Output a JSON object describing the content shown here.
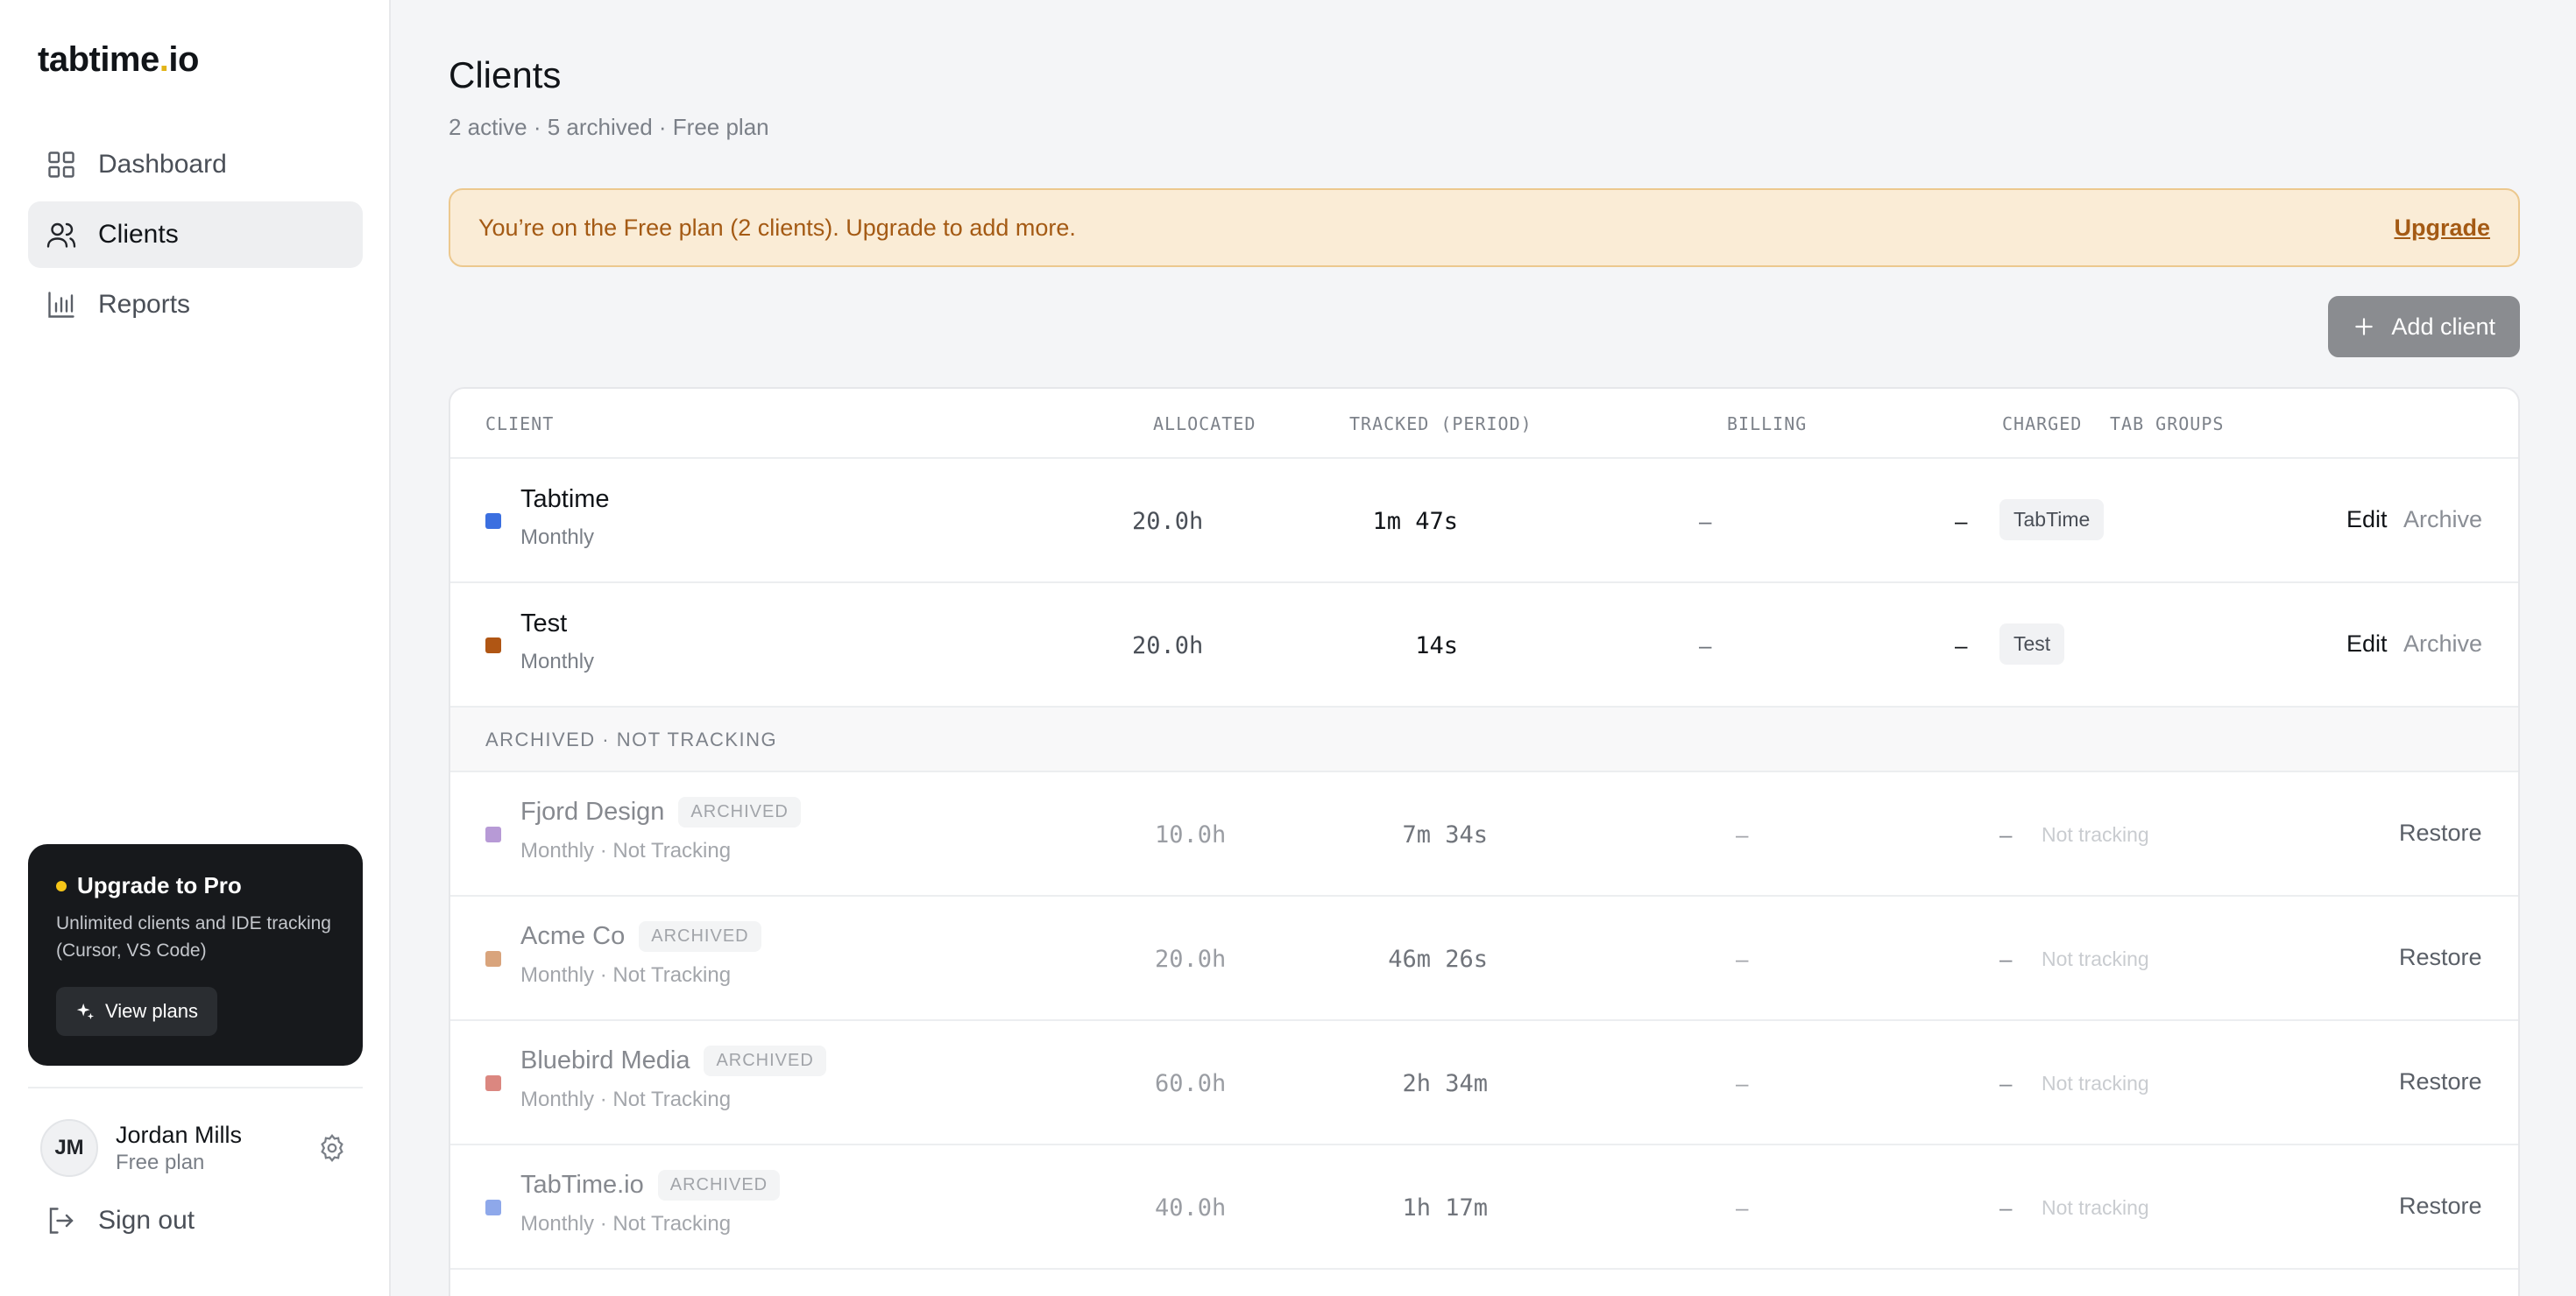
{
  "brand": {
    "name_main": "tabtime",
    "name_dot": ".",
    "name_tld": "io"
  },
  "nav": [
    {
      "label": "Dashboard",
      "icon": "grid-icon",
      "active": false
    },
    {
      "label": "Clients",
      "icon": "users-icon",
      "active": true
    },
    {
      "label": "Reports",
      "icon": "bar-chart-icon",
      "active": false
    }
  ],
  "promo": {
    "title": "Upgrade to Pro",
    "text": "Unlimited clients and IDE tracking (Cursor, VS Code)",
    "button": "View plans"
  },
  "user": {
    "initials": "JM",
    "name": "Jordan Mills",
    "plan": "Free plan",
    "signout": "Sign out"
  },
  "page": {
    "title": "Clients",
    "subtitle": "2 active · 5 archived · Free plan",
    "banner_text": "You’re on the Free plan (2 clients). Upgrade to add more.",
    "banner_link": "Upgrade",
    "add_button": "Add client"
  },
  "table": {
    "headers": {
      "client": "CLIENT",
      "allocated": "ALLOCATED",
      "tracked": "TRACKED (PERIOD)",
      "billing": "BILLING",
      "charged": "CHARGED",
      "tab_groups": "TAB GROUPS"
    },
    "active": [
      {
        "name": "Tabtime",
        "period": "Monthly",
        "color": "#3b6fe0",
        "allocated": "20.0h",
        "tracked": "1m 47s",
        "billing": "–",
        "charged": "–",
        "tag": "TabTime",
        "edit": "Edit",
        "archive": "Archive"
      },
      {
        "name": "Test",
        "period": "Monthly",
        "color": "#b05614",
        "allocated": "20.0h",
        "tracked": "14s",
        "billing": "–",
        "charged": "–",
        "tag": "Test",
        "edit": "Edit",
        "archive": "Archive"
      }
    ],
    "archived_heading": "ARCHIVED · NOT TRACKING",
    "archived": [
      {
        "name": "Fjord Design",
        "badge": "ARCHIVED",
        "period": "Monthly · Not Tracking",
        "color": "#b79ad6",
        "allocated": "10.0h",
        "tracked": "7m 34s",
        "billing": "–",
        "charged": "–",
        "tag_status": "Not tracking",
        "restore": "Restore"
      },
      {
        "name": "Acme Co",
        "badge": "ARCHIVED",
        "period": "Monthly · Not Tracking",
        "color": "#d9a47c",
        "allocated": "20.0h",
        "tracked": "46m 26s",
        "billing": "–",
        "charged": "–",
        "tag_status": "Not tracking",
        "restore": "Restore"
      },
      {
        "name": "Bluebird Media",
        "badge": "ARCHIVED",
        "period": "Monthly · Not Tracking",
        "color": "#db8780",
        "allocated": "60.0h",
        "tracked": "2h 34m",
        "billing": "–",
        "charged": "–",
        "tag_status": "Not tracking",
        "restore": "Restore"
      },
      {
        "name": "TabTime.io",
        "badge": "ARCHIVED",
        "period": "Monthly · Not Tracking",
        "color": "#8ea8ea",
        "allocated": "40.0h",
        "tracked": "1h 17m",
        "billing": "–",
        "charged": "–",
        "tag_status": "Not tracking",
        "restore": "Restore"
      }
    ]
  }
}
